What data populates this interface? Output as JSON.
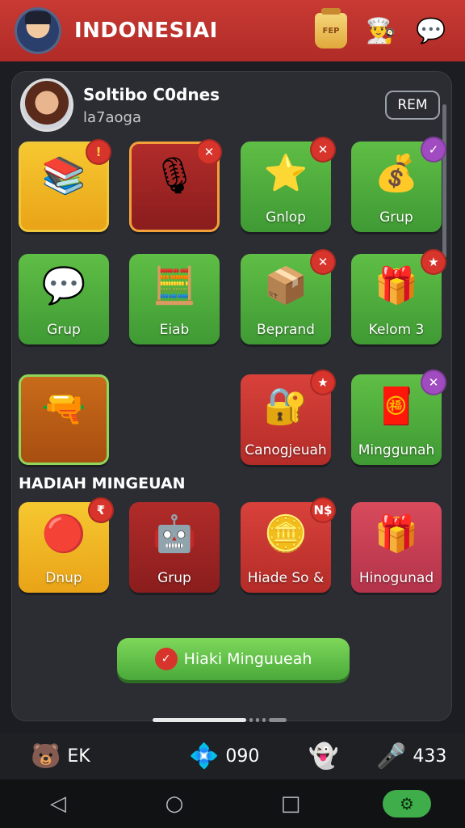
{
  "header": {
    "title": "INDONESIAI",
    "jar_label": "FEP"
  },
  "profile": {
    "name": "Soltibo C0dnes",
    "subtitle": "la7aoga",
    "rev_button": "REM"
  },
  "grid_rows": [
    [
      {
        "label": "",
        "badge": "!",
        "badge_style": "excl",
        "color": "yellow",
        "icon": "books-and-bear-icon"
      },
      {
        "label": "",
        "badge": "✕",
        "badge_style": "red",
        "color": "darkred",
        "icon": "microphone-icon"
      },
      {
        "label": "Gnlop",
        "badge": "✕",
        "badge_style": "red",
        "color": "green",
        "icon": "star-icon"
      },
      {
        "label": "Grup",
        "badge": "✓",
        "badge_style": "purple",
        "color": "green",
        "icon": "gold-dollar-icon"
      }
    ],
    [
      {
        "label": "Grup",
        "badge": "",
        "color": "green",
        "icon": "chat-bubble-icon"
      },
      {
        "label": "Eiab",
        "badge": "",
        "color": "green",
        "icon": "calculator-icon"
      },
      {
        "label": "Beprand",
        "badge": "✕",
        "badge_style": "red",
        "color": "green",
        "icon": "blue-box-icon"
      },
      {
        "label": "Kelom 3",
        "badge": "★",
        "badge_style": "red",
        "color": "green",
        "icon": "gift-icon"
      }
    ],
    [
      {
        "label": "",
        "badge": "",
        "color": "orange",
        "icon": "cannon-icon"
      },
      {
        "label": "Canogjeuah",
        "badge": "★",
        "badge_style": "red",
        "color": "red",
        "icon": "safe-box-icon"
      },
      {
        "label": "Minggunah",
        "badge": "✕",
        "badge_style": "purple",
        "color": "green",
        "icon": "red-chest-icon"
      }
    ]
  ],
  "section_title": "HADIAH MINGEUAN",
  "weekly_rewards": [
    {
      "label": "Dnup",
      "badge": "₹",
      "color": "yellow",
      "icon": "red-button-icon"
    },
    {
      "label": "Grup",
      "badge": "",
      "color": "darkred",
      "icon": "robot-icon"
    },
    {
      "label": "Hiade So &",
      "badge": "N$",
      "color": "red",
      "icon": "gold-coins-icon"
    },
    {
      "label": "Hinogunad",
      "badge": "",
      "color": "pink",
      "icon": "gift-star-icon"
    }
  ],
  "claim_button": {
    "label": "Hiaki Minguueah",
    "icon": "check-icon"
  },
  "resources": [
    {
      "icon": "bear-icon",
      "value": "EK"
    },
    {
      "icon": "crystal-icon",
      "value": "090"
    },
    {
      "icon": "ghost-icon",
      "value": ""
    },
    {
      "icon": "microphone-icon",
      "value": "433"
    }
  ],
  "navbar": {
    "back": "◁",
    "home": "○",
    "recents": "□",
    "settings": "⚙"
  }
}
